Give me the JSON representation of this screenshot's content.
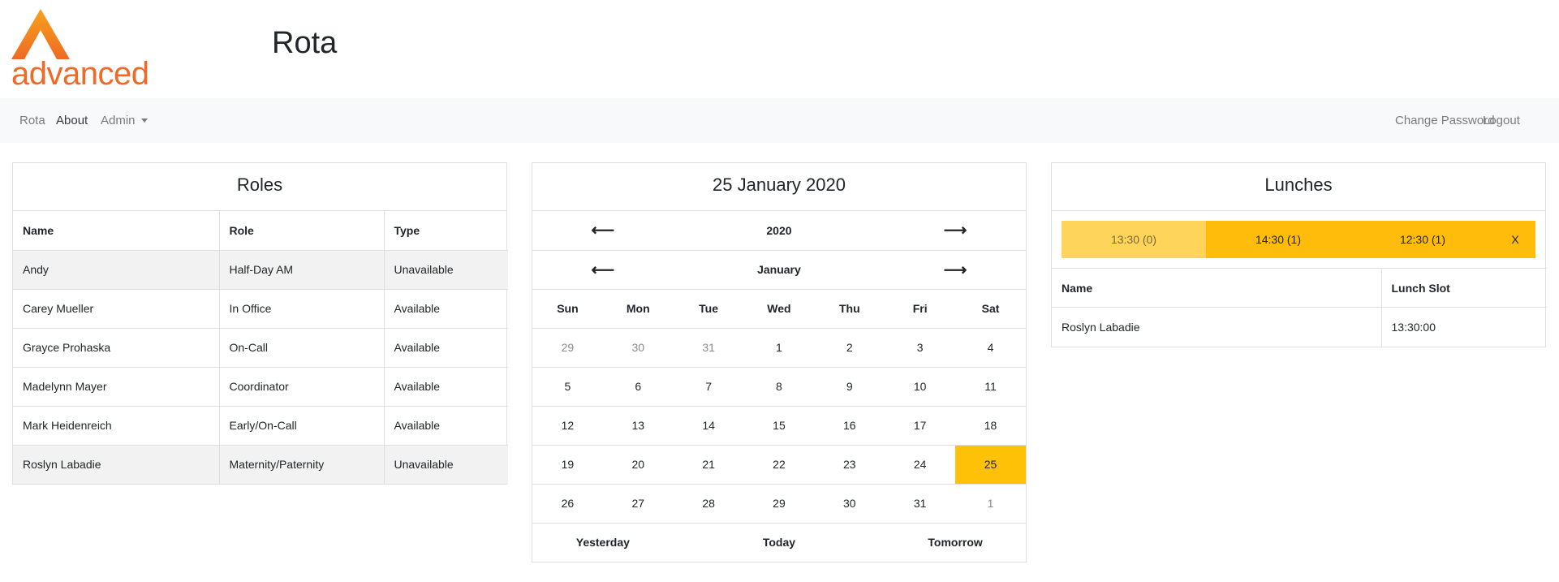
{
  "brand": {
    "logo_text": "advanced",
    "logo_color": "#ee6a25",
    "logo_accent": "#f7a21b"
  },
  "app_title": "Rota",
  "navbar": {
    "left": [
      "Rota",
      "About",
      "Admin"
    ],
    "right": [
      "Change Password",
      "Logout"
    ],
    "active": "About"
  },
  "roles": {
    "title": "Roles",
    "columns": [
      "Name",
      "Role",
      "Type"
    ],
    "rows": [
      [
        "Andy",
        "Half-Day AM",
        "Unavailable"
      ],
      [
        "Carey Mueller",
        "In Office",
        "Available"
      ],
      [
        "Grayce Prohaska",
        "On-Call",
        "Available"
      ],
      [
        "Madelynn Mayer",
        "Coordinator",
        "Available"
      ],
      [
        "Mark Heidenreich",
        "Early/On-Call",
        "Available"
      ],
      [
        "Roslyn Labadie",
        "Maternity/Paternity",
        "Unavailable"
      ]
    ]
  },
  "calendar": {
    "title": "25 January 2020",
    "year": "2020",
    "month": "January",
    "prev_arrow": "⟵",
    "next_arrow": "⟶",
    "weekdays": [
      "Sun",
      "Mon",
      "Tue",
      "Wed",
      "Thu",
      "Fri",
      "Sat"
    ],
    "weeks": [
      [
        "29",
        "30",
        "31",
        "1",
        "2",
        "3",
        "4"
      ],
      [
        "5",
        "6",
        "7",
        "8",
        "9",
        "10",
        "11"
      ],
      [
        "12",
        "13",
        "14",
        "15",
        "16",
        "17",
        "18"
      ],
      [
        "19",
        "20",
        "21",
        "22",
        "23",
        "24",
        "25"
      ],
      [
        "26",
        "27",
        "28",
        "29",
        "30",
        "31",
        "1"
      ]
    ],
    "selected_day": "25",
    "footer": [
      "Yesterday",
      "Today",
      "Tomorrow"
    ],
    "highlight_color": "#ffc107"
  },
  "lunches": {
    "title": "Lunches",
    "slots": [
      "13:30 (0)",
      "14:30 (1)",
      "12:30 (1)"
    ],
    "close_label": "X",
    "slot_colors": {
      "empty": "#ffd45a",
      "filled": "#ffbc0a"
    },
    "columns": [
      "Name",
      "Lunch Slot"
    ],
    "rows": [
      [
        "Roslyn Labadie",
        "13:30:00"
      ]
    ]
  }
}
